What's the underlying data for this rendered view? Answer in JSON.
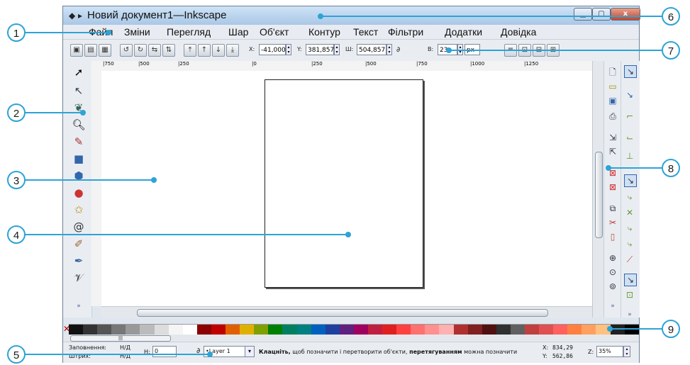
{
  "window": {
    "title": "Новий документ1—Inkscape",
    "close_label": "x"
  },
  "menu": [
    "Файл",
    "Зміни",
    "Перегляд",
    "Шар",
    "Об'єкт",
    "Контур",
    "Текст",
    "Фільтри",
    "Додатки",
    "Довідка"
  ],
  "coords": {
    "x_label": "X:",
    "x_value": "-41,000",
    "y_label": "Y:",
    "y_value": "381,857",
    "w_label": "Ш:",
    "w_value": "504,857",
    "h_label": "В:",
    "h_value": "23",
    "unit": "px"
  },
  "ruler_ticks": [
    "|750",
    "|500",
    "|250",
    "|0",
    "|250",
    "|500",
    "|750",
    "|1000",
    "|1250"
  ],
  "status": {
    "fill_label": "Заповнення:",
    "fill_value": "Н/Д",
    "stroke_label": "Штрих:",
    "stroke_value": "Н/Д",
    "h_label": "Н:",
    "h_value": "0",
    "layer": "•Layer 1",
    "hint_bold1": "Клацніть,",
    "hint_mid": "щоб позначити і перетворити об'єкти,",
    "hint_bold2": "перетягуванням",
    "hint_end": "можна позначити",
    "cursor_x_label": "X:",
    "cursor_x": "834,29",
    "cursor_y_label": "Y:",
    "cursor_y": "562,86",
    "zoom_label": "Z:",
    "zoom": "35%"
  },
  "callouts": [
    "1",
    "2",
    "3",
    "4",
    "5",
    "6",
    "7",
    "8",
    "9"
  ],
  "palette_colors": [
    "#111111",
    "#333333",
    "#555555",
    "#777777",
    "#999999",
    "#bbbbbb",
    "#dddddd",
    "#f5f5f5",
    "#ffffff",
    "#8b0000",
    "#c00000",
    "#e06000",
    "#e0b000",
    "#80a000",
    "#008000",
    "#008060",
    "#008080",
    "#0060c0",
    "#2040a0",
    "#602080",
    "#a00060",
    "#c02040",
    "#e02020",
    "#ff4040",
    "#ff7070",
    "#ff9090",
    "#ffb0b0",
    "#b03030",
    "#802020",
    "#501010",
    "#303030",
    "#606060",
    "#c04040",
    "#e05050",
    "#ff6060",
    "#ff8040",
    "#ffa060",
    "#ffc080",
    "#202020",
    "#000000"
  ],
  "accent": "#2ea3d6"
}
